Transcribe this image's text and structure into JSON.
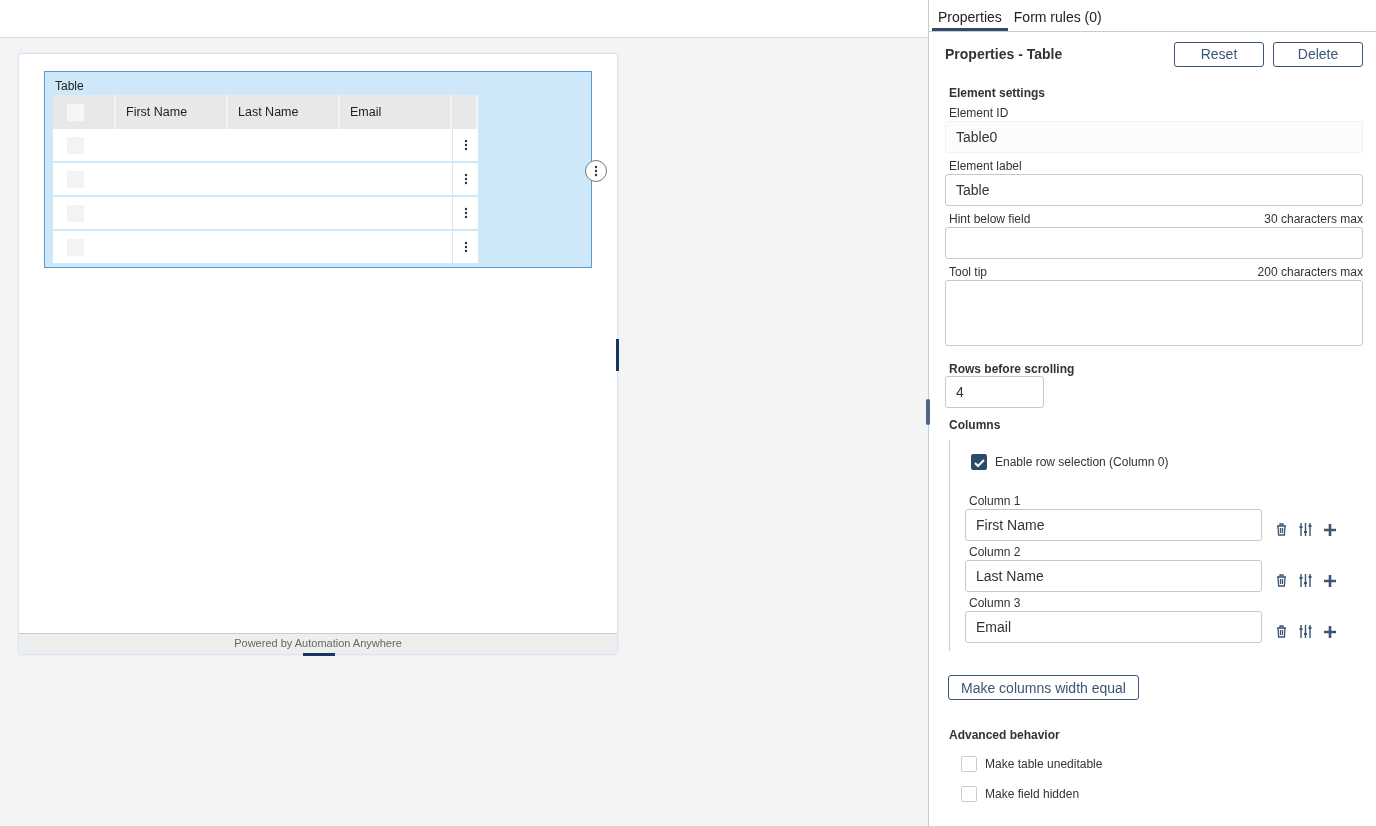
{
  "canvas": {
    "table": {
      "label": "Table",
      "all_selected": false,
      "columns": [
        "First Name",
        "Last Name",
        "Email"
      ],
      "rows": [
        {
          "selected": false
        },
        {
          "selected": false
        },
        {
          "selected": false
        },
        {
          "selected": false
        }
      ]
    },
    "footer": "Powered by Automation Anywhere"
  },
  "panel": {
    "tabs": [
      {
        "label": "Properties",
        "selected": true
      },
      {
        "label": "Form rules (0)",
        "selected": false
      }
    ],
    "title": "Properties - Table",
    "buttons": [
      "Reset",
      "Delete"
    ],
    "section": "Element settings",
    "element_id": {
      "label": "Element ID",
      "value": "Table0",
      "disabled": true
    },
    "element_label": {
      "label": "Element label",
      "value": "Table"
    },
    "hint": {
      "label": "Hint below field",
      "limit": "30 characters max"
    },
    "tooltip": {
      "label": "Tool tip",
      "limit": "200 characters max"
    },
    "rows_before_scrolling": {
      "label": "Rows before scrolling",
      "value": "4"
    },
    "columns": {
      "title": "Columns",
      "row_selection": {
        "label": "Enable row selection (Column 0)",
        "checked": true
      },
      "items": [
        {
          "label": "Column 1",
          "value": "First Name"
        },
        {
          "label": "Column 2",
          "value": "Last Name"
        },
        {
          "label": "Column 3",
          "value": "Email"
        }
      ]
    },
    "equal_button": "Make columns width equal",
    "advanced": {
      "title": "Advanced behavior",
      "options": [
        {
          "label": "Make table uneditable",
          "checked": false
        },
        {
          "label": "Make field hidden",
          "checked": false
        }
      ]
    }
  }
}
